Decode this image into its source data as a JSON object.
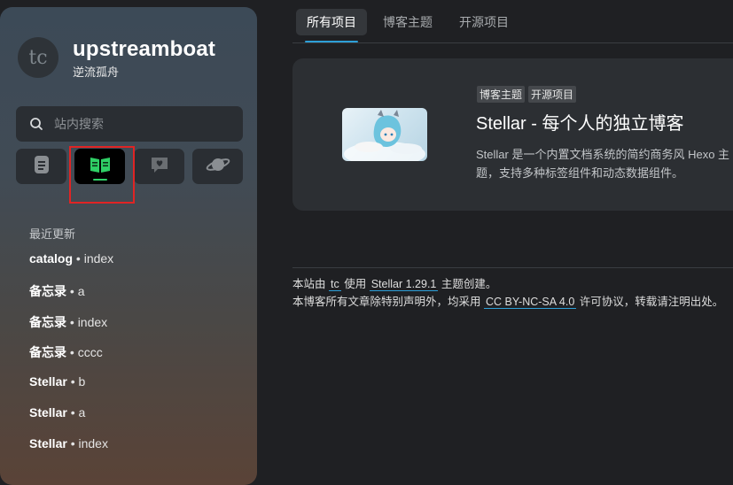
{
  "site": {
    "avatar_text": "tc",
    "title": "upstreamboat",
    "subtitle": "逆流孤舟"
  },
  "search": {
    "placeholder": "站内搜索"
  },
  "nav_buttons": [
    {
      "icon": "document-icon"
    },
    {
      "icon": "wiki-book-icon",
      "active": true
    },
    {
      "icon": "heart-chat-icon"
    },
    {
      "icon": "planet-icon"
    }
  ],
  "recent": {
    "title": "最近更新",
    "items": [
      {
        "name": "catalog",
        "sep": " • ",
        "page": "index"
      },
      {
        "name": "备忘录",
        "sep": " • ",
        "page": "a"
      },
      {
        "name": "备忘录",
        "sep": " • ",
        "page": "index"
      },
      {
        "name": "备忘录",
        "sep": " • ",
        "page": "cccc"
      },
      {
        "name": "Stellar",
        "sep": " • ",
        "page": "b"
      },
      {
        "name": "Stellar",
        "sep": " • ",
        "page": "a"
      },
      {
        "name": "Stellar",
        "sep": " • ",
        "page": "index"
      }
    ]
  },
  "tabs": [
    {
      "label": "所有项目",
      "active": true
    },
    {
      "label": "博客主题"
    },
    {
      "label": "开源项目"
    }
  ],
  "card": {
    "tags": [
      "博客主题",
      "开源项目"
    ],
    "title": "Stellar - 每个人的独立博客",
    "desc": "Stellar 是一个内置文档系统的简约商务风 Hexo 主题，支持多种标签组件和动态数据组件。"
  },
  "footer": {
    "line1_prefix": "本站由",
    "line1_author": "tc",
    "line1_mid": "使用",
    "line1_theme": "Stellar 1.29.1",
    "line1_suffix": "主题创建。",
    "line2_prefix": "本博客所有文章除特别声明外，均采用",
    "line2_license": "CC BY-NC-SA 4.0",
    "line2_suffix": "许可协议，转载请注明出处。"
  },
  "colors": {
    "accent_blue": "#2d9fd8",
    "active_green": "#2fd066",
    "highlight_red": "#e02424"
  }
}
